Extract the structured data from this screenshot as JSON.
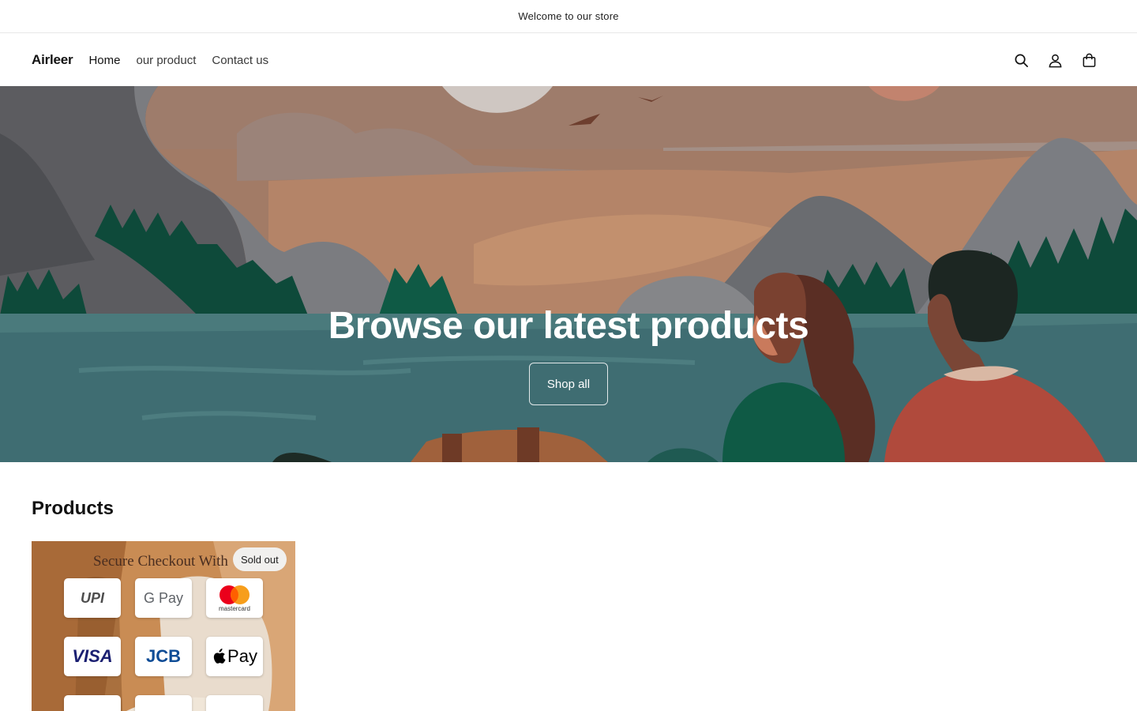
{
  "announcement": {
    "text": "Welcome to our store"
  },
  "header": {
    "logo": "Airleer",
    "nav": [
      {
        "label": "Home"
      },
      {
        "label": "our product"
      },
      {
        "label": "Contact us"
      }
    ],
    "icons": [
      "search-icon",
      "account-icon",
      "cart-icon"
    ]
  },
  "hero": {
    "title": "Browse our latest products",
    "button_label": "Shop all"
  },
  "products": {
    "heading": "Products",
    "items": [
      {
        "badge": "Sold out",
        "image_title": "Secure Checkout With",
        "payment_methods": [
          "UPI",
          "G Pay",
          "mastercard",
          "VISA",
          "JCB",
          "Pay"
        ]
      }
    ]
  },
  "colors": {
    "water": "#3f6d72",
    "trees": "#0e4a3a",
    "sky": "#a57e68",
    "mountain": "#6b6d70"
  }
}
